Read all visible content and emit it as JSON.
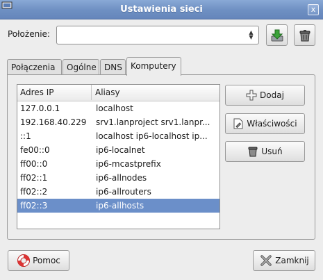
{
  "window": {
    "title": "Ustawienia sieci",
    "close_glyph": "x"
  },
  "location": {
    "label": "Położenie:",
    "value": ""
  },
  "toolbar": {
    "save_icon": "save-location-icon",
    "delete_icon": "delete-location-icon"
  },
  "tabs": [
    {
      "label": "Połączenia"
    },
    {
      "label": "Ogólne"
    },
    {
      "label": "DNS"
    },
    {
      "label": "Komputery",
      "active": true
    }
  ],
  "hosts": {
    "columns": {
      "ip": "Adres IP",
      "alias": "Aliasy"
    },
    "rows": [
      {
        "ip": "127.0.0.1",
        "alias": "localhost"
      },
      {
        "ip": "192.168.40.229",
        "alias": "srv1.lanproject srv1.lanpr..."
      },
      {
        "ip": "::1",
        "alias": "localhost ip6-localhost ip..."
      },
      {
        "ip": "fe00::0",
        "alias": "ip6-localnet"
      },
      {
        "ip": "ff00::0",
        "alias": "ip6-mcastprefix"
      },
      {
        "ip": "ff02::1",
        "alias": "ip6-allnodes"
      },
      {
        "ip": "ff02::2",
        "alias": "ip6-allrouters"
      },
      {
        "ip": "ff02::3",
        "alias": "ip6-allhosts",
        "selected": true
      }
    ]
  },
  "actions": {
    "add": "Dodaj",
    "properties": "Właściwości",
    "remove": "Usuń"
  },
  "footer": {
    "help": "Pomoc",
    "close": "Zamknij"
  },
  "colors": {
    "titlebar": "#6e8fc2",
    "selection": "#6b8fc9",
    "save_green": "#3aa33a"
  }
}
